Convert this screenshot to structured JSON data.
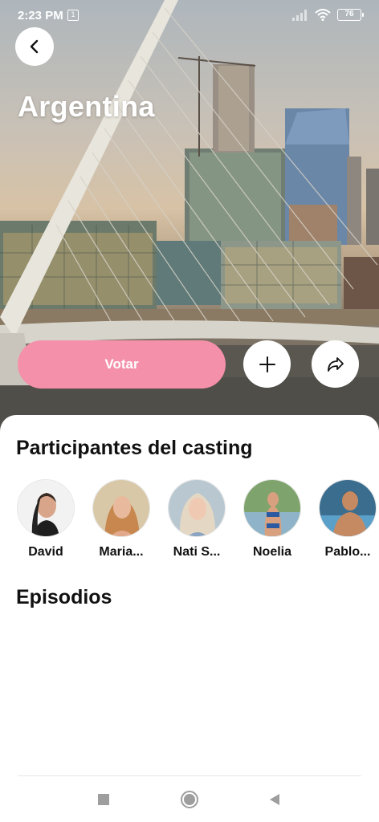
{
  "status_bar": {
    "time": "2:23 PM",
    "notification_badge": "1",
    "battery": "76"
  },
  "header": {
    "title": "Argentina",
    "back_icon": "chevron-left-icon"
  },
  "actions": {
    "vote_label": "Votar",
    "vote_color": "#f590aa",
    "add_icon": "plus-icon",
    "share_icon": "share-arrow-icon"
  },
  "participants_section": {
    "title": "Participantes del casting",
    "participants": [
      {
        "name": "David"
      },
      {
        "name": "Maria..."
      },
      {
        "name": "Nati S..."
      },
      {
        "name": "Noelia"
      },
      {
        "name": "Pablo..."
      }
    ]
  },
  "episodes_section": {
    "title": "Episodios"
  },
  "nav_bar": {
    "recents_icon": "square-icon",
    "home_icon": "circle-home-icon",
    "back_icon": "triangle-back-icon"
  }
}
